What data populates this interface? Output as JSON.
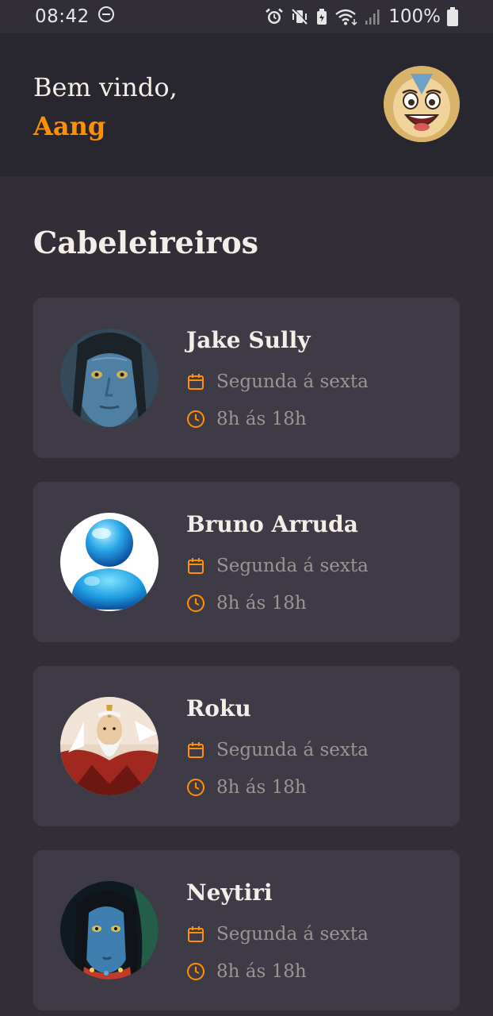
{
  "status_bar": {
    "time": "08:42",
    "battery": "100%"
  },
  "header": {
    "welcome_text": "Bem vindo,",
    "user_name": "Aang",
    "avatar_icon": "profile-avatar"
  },
  "section": {
    "title": "Cabeleireiros"
  },
  "providers": [
    {
      "name": "Jake Sully",
      "days": "Segunda á sexta",
      "hours": "8h ás 18h"
    },
    {
      "name": "Bruno Arruda",
      "days": "Segunda á sexta",
      "hours": "8h ás 18h"
    },
    {
      "name": "Roku",
      "days": "Segunda á sexta",
      "hours": "8h ás 18h"
    },
    {
      "name": "Neytiri",
      "days": "Segunda á sexta",
      "hours": "8h ás 18h"
    }
  ],
  "colors": {
    "background": "#312E38",
    "header": "#28262E",
    "card": "#3E3B47",
    "accent": "#FF9000",
    "text": "#F4EDE8",
    "muted": "#999591"
  }
}
